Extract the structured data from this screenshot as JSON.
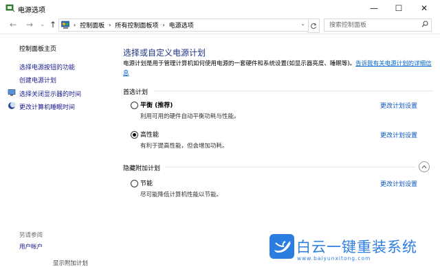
{
  "window": {
    "title": "电源选项",
    "min_glyph": "—",
    "max_glyph": "☐",
    "close_glyph": "✕"
  },
  "nav": {
    "back_glyph": "←",
    "forward_glyph": "→",
    "recent_glyph": "⌄",
    "up_glyph": "↑",
    "breadcrumb": [
      "控制面板",
      "所有控制面板项",
      "电源选项"
    ],
    "separator": "›",
    "search_placeholder": "搜索控制面板"
  },
  "sidebar": {
    "home": "控制面板主页",
    "links": [
      "选择电源按钮的功能",
      "创建电源计划",
      "选择关闭显示器的时间",
      "更改计算机睡眠时间"
    ],
    "see_also_label": "另请参阅",
    "see_also": "用户帐户"
  },
  "main": {
    "heading": "选择或自定义电源计划",
    "description": "电源计划是用于管理计算机如何使用电源的一套硬件和系统设置(如显示器亮度、睡眠等)。",
    "description_link": "告诉我有关电源计划的详细信息",
    "preferred_label": "首选计划",
    "hidden_label": "隐藏附加计划",
    "change_label": "更改计划设置",
    "plans": [
      {
        "name": "平衡 (推荐)",
        "desc": "利用可用的硬件自动平衡功耗与性能。",
        "selected": false
      },
      {
        "name": "高性能",
        "desc": "有利于提高性能，但会增加功耗。",
        "selected": true
      },
      {
        "name": "节能",
        "desc": "尽可能降低计算机性能以节能。",
        "selected": false
      }
    ],
    "ghost_bottom": "显示附加计划"
  },
  "watermark": {
    "brand": "白云一键重装系统",
    "url": "www.baiyunxitong.com"
  },
  "colors": {
    "link": "#1a1a8f",
    "heading": "#1e3287",
    "accent": "#2c7de0"
  }
}
